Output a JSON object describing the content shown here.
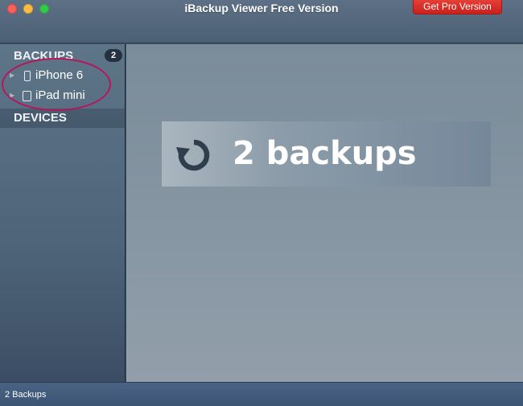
{
  "window": {
    "title": "iBackup Viewer Free Version",
    "pro_button_label": "Get Pro Version"
  },
  "sidebar": {
    "backups_header": "BACKUPS",
    "backups_count": "2",
    "items": [
      {
        "label": "iPhone 6",
        "icon": "phone-icon"
      },
      {
        "label": "iPad mini",
        "icon": "tablet-icon"
      }
    ],
    "devices_header": "DEVICES"
  },
  "main": {
    "banner_text": "2 backups",
    "banner_icon": "refresh-icon"
  },
  "status": {
    "text": "2 Backups"
  },
  "colors": {
    "pro_button": "#d42d26",
    "annotation": "#b3185d",
    "badge": "#243140"
  }
}
